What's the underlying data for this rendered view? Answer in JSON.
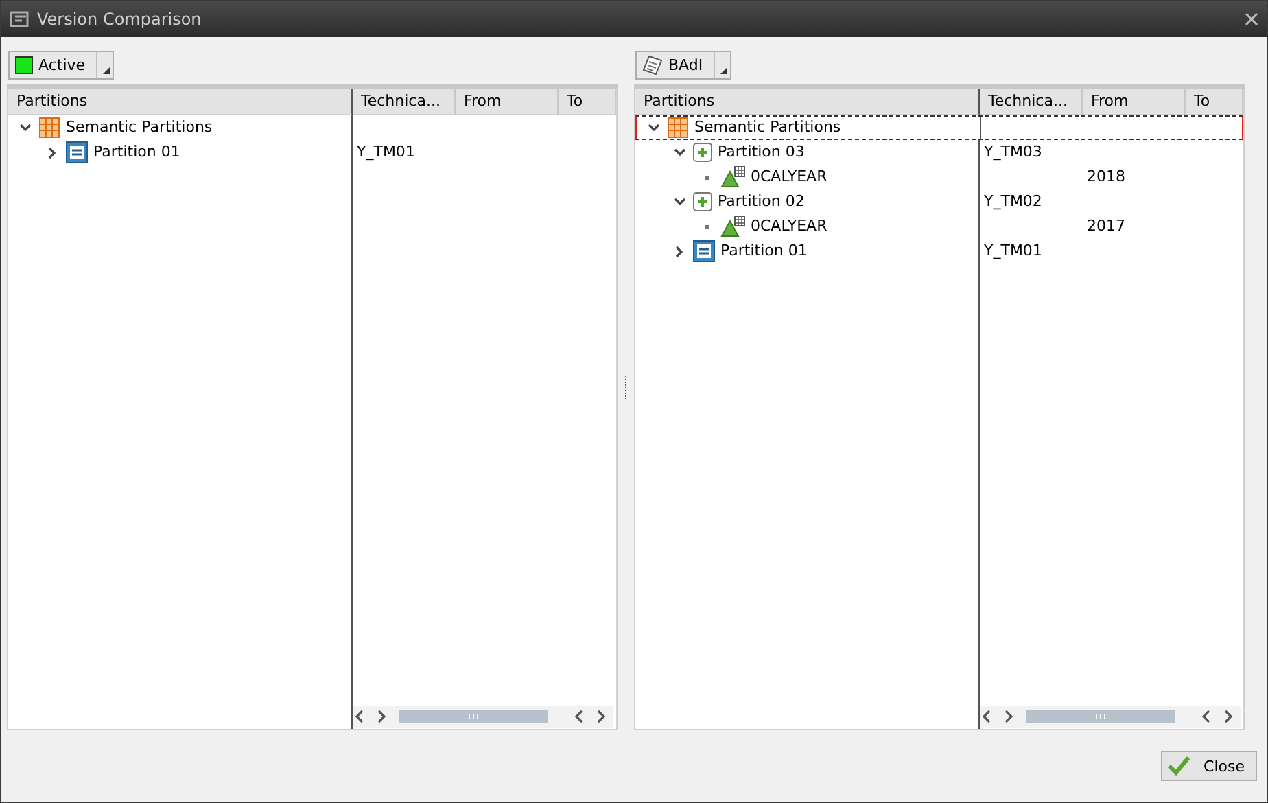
{
  "window": {
    "title": "Version Comparison"
  },
  "panels": [
    {
      "version": {
        "label": "Active",
        "kind": "active"
      },
      "columns": [
        "Partitions",
        "Technica...",
        "From",
        "To"
      ],
      "tree": [
        {
          "label": "Semantic Partitions",
          "kind": "semantic",
          "expanded": true,
          "selected": false,
          "children": [
            {
              "label": "Partition 01",
              "kind": "partition",
              "technical": "Y_TM01",
              "expanded": false,
              "selected": false
            }
          ]
        }
      ]
    },
    {
      "version": {
        "label": "BAdI",
        "kind": "badi"
      },
      "columns": [
        "Partitions",
        "Technica...",
        "From",
        "To"
      ],
      "tree": [
        {
          "label": "Semantic Partitions",
          "kind": "semantic",
          "expanded": true,
          "selected": true,
          "children": [
            {
              "label": "Partition 03",
              "kind": "new-partition",
              "technical": "Y_TM03",
              "expanded": true,
              "selected": false,
              "children": [
                {
                  "label": "0CALYEAR",
                  "kind": "characteristic",
                  "from": "2018",
                  "selected": false
                }
              ]
            },
            {
              "label": "Partition 02",
              "kind": "new-partition",
              "technical": "Y_TM02",
              "expanded": true,
              "selected": false,
              "children": [
                {
                  "label": "0CALYEAR",
                  "kind": "characteristic",
                  "from": "2017",
                  "selected": false
                }
              ]
            },
            {
              "label": "Partition 01",
              "kind": "partition",
              "technical": "Y_TM01",
              "expanded": false,
              "selected": false
            }
          ]
        }
      ]
    }
  ],
  "buttons": [
    {
      "label": "Close"
    }
  ]
}
